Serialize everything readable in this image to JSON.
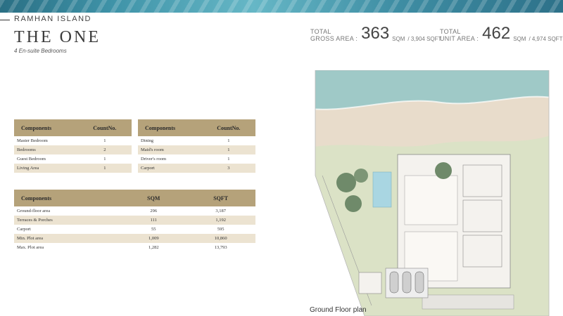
{
  "header": {
    "location": "RAMHAN ISLAND",
    "title": "THE ONE",
    "subtitle": "4 En-suite Bedrooms"
  },
  "stats": {
    "gross": {
      "label_line1": "TOTAL",
      "label_line2": "GROSS AREA :",
      "value": "363",
      "unit": "SQM",
      "alt": "/ 3,904 SQFT"
    },
    "unit": {
      "label_line1": "TOTAL",
      "label_line2": "UNIT AREA :",
      "value": "462",
      "unit": "SQM",
      "alt": "/ 4,974 SQFT"
    }
  },
  "table_rooms_left": {
    "headers": [
      "Components",
      "CountNo."
    ],
    "rows": [
      [
        "Master Bedroom",
        "1"
      ],
      [
        "Bedrooms",
        "2"
      ],
      [
        "Guest Bedroom",
        "1"
      ],
      [
        "Living Area",
        "1"
      ]
    ]
  },
  "table_rooms_right": {
    "headers": [
      "Components",
      "CountNo."
    ],
    "rows": [
      [
        "Dining",
        "1"
      ],
      [
        "Maid's room",
        "1"
      ],
      [
        "Driver's room",
        "1"
      ],
      [
        "Carport",
        "3"
      ]
    ]
  },
  "table_areas": {
    "headers": [
      "Components",
      "SQM",
      "SQFT"
    ],
    "rows": [
      [
        "Ground-floor area",
        "296",
        "3,187"
      ],
      [
        "Terraces & Porches",
        "111",
        "1,192"
      ],
      [
        "Carport",
        "55",
        "595"
      ],
      [
        "Min. Plot area",
        "1,009",
        "10,860"
      ],
      [
        "Max. Plot area",
        "1,282",
        "13,793"
      ]
    ]
  },
  "plan": {
    "caption": "Ground Floor plan",
    "colors": {
      "sea": "#9fc9c7",
      "sand": "#e8dccb",
      "grass": "#dbe2c6",
      "building": "#f4f2ee",
      "pool": "#a9d6e2",
      "tree": "#6f8a6a"
    }
  }
}
